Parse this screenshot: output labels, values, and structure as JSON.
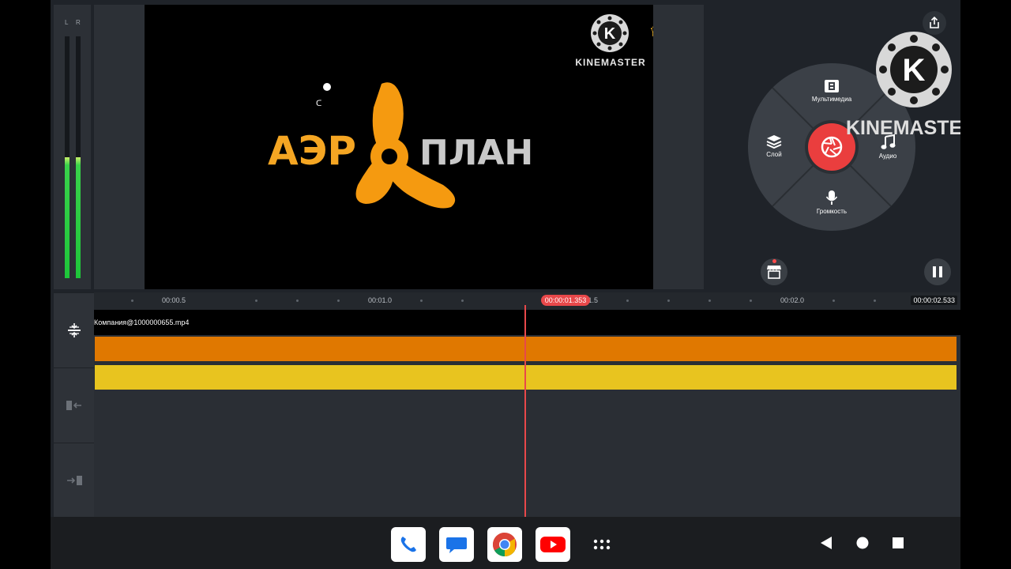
{
  "meters": {
    "left_label": "L",
    "right_label": "R",
    "left_level": 0.5,
    "right_level": 0.5
  },
  "preview": {
    "title_art": "АЭРОПЛАН",
    "watermark": "KINEMASTER"
  },
  "controls": {
    "brand_text": "KINEMASTER",
    "wheel": {
      "media_label": "Мультимедиа",
      "layer_label": "Слой",
      "audio_label": "Аудио",
      "volume_label": "Громкость"
    }
  },
  "timeline": {
    "ticks": [
      "00:00.5",
      "00:01.0",
      "00:01.5",
      "00:02.0"
    ],
    "current_time": "00:00:01.353",
    "total_time": "00:00:02.533",
    "clip_name": "Компания@1000000655.mp4"
  },
  "colors": {
    "track_orange": "#e07800",
    "track_yellow": "#e8c41f",
    "playhead": "#e8484a",
    "record": "#ea3e3e"
  },
  "taskbar": {
    "apps": [
      "phone-icon",
      "messages-icon",
      "chrome-icon",
      "youtube-icon",
      "app-drawer-icon"
    ],
    "nav": [
      "back-icon",
      "home-icon",
      "recents-icon"
    ]
  }
}
